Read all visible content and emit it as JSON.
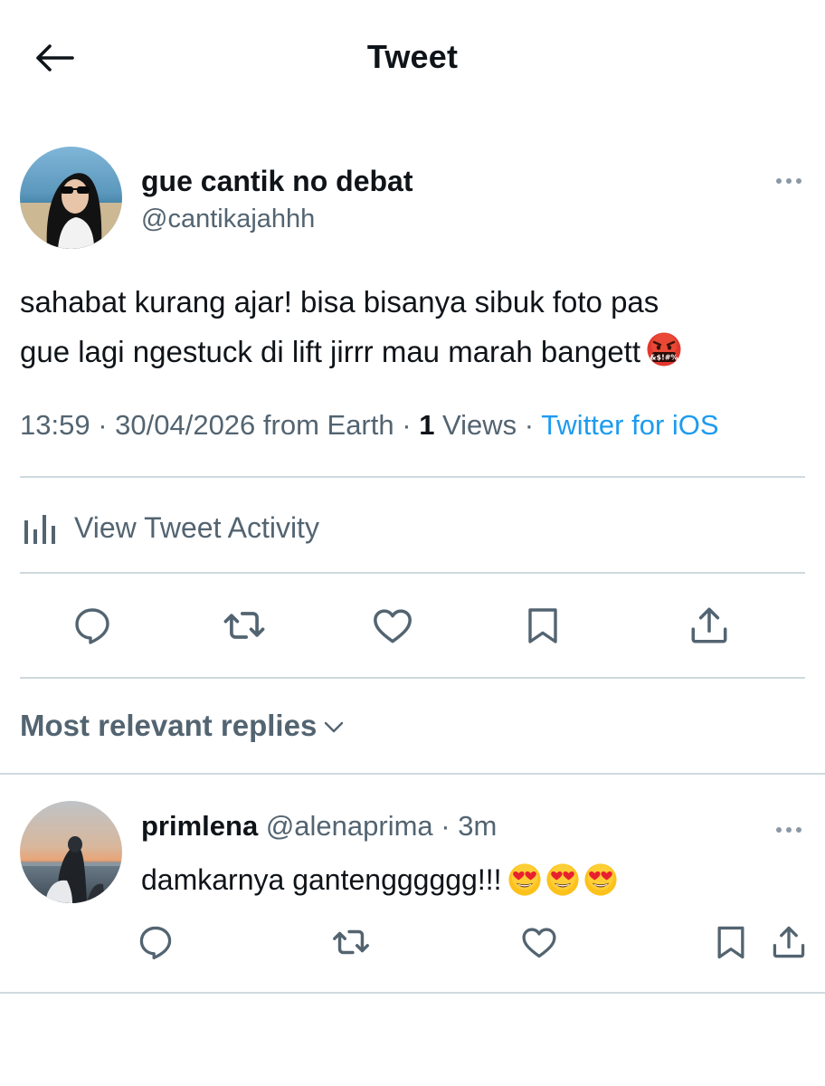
{
  "header": {
    "title": "Tweet",
    "back_icon": "arrow-left-icon"
  },
  "tweet": {
    "author_name": "gue cantik no debat",
    "author_handle": "@cantikajahhh",
    "text_line1": "sahabat kurang ajar! bisa bisanya sibuk foto pas",
    "text_line2": "gue lagi ngestuck di lift jirrr mau marah bangett",
    "emoji": "face-with-symbols-on-mouth",
    "emoji_symbols": "&$!#%",
    "time": "13:59",
    "date": "30/04/2026 from Earth",
    "views_count": "1",
    "views_label": " Views",
    "source": "Twitter for iOS",
    "separator": " · "
  },
  "activity": {
    "label": "View Tweet Activity",
    "icon": "analytics-bars-icon"
  },
  "actions": [
    "reply-icon",
    "retweet-icon",
    "like-icon",
    "bookmark-icon",
    "share-icon"
  ],
  "replies_header": {
    "label": "Most relevant replies"
  },
  "reply": {
    "name": "primlena",
    "handle": " @alenaprima",
    "time": " · 3m",
    "text": "damkarnya gantengggggg!!!",
    "emoji": "smiling-face-with-heart-eyes",
    "emoji_count": 3
  },
  "colors": {
    "text": "#0f1419",
    "secondary": "#536471",
    "link": "#1d9bf0",
    "divider": "#cfd9de"
  }
}
